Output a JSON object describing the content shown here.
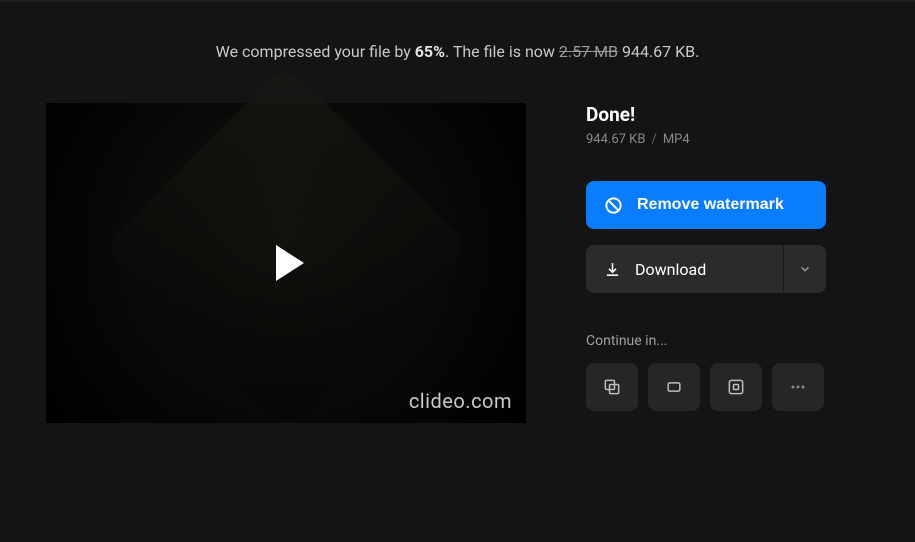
{
  "message": {
    "prefix": "We compressed your file by ",
    "percent": "65%",
    "middle": ". The file is now ",
    "old_size": "2.57 MB",
    "new_size": " 944.67 KB."
  },
  "video": {
    "watermark": "clideo.com"
  },
  "side": {
    "title": "Done!",
    "file_size": "944.67 KB",
    "file_format": "MP4",
    "remove_watermark_label": "Remove watermark",
    "download_label": "Download",
    "continue_label": "Continue in..."
  }
}
